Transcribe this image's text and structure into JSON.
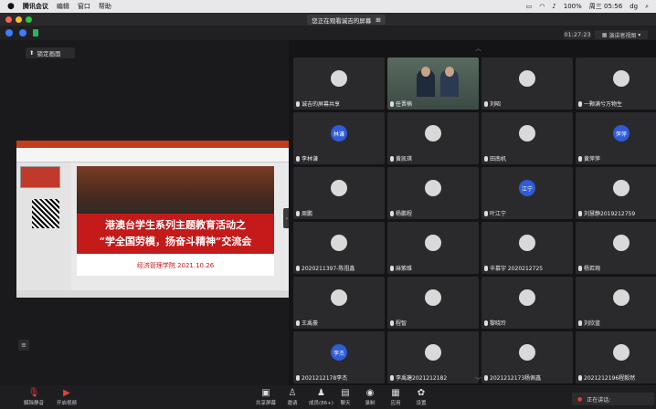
{
  "menubar": {
    "apple": "",
    "app": "腾讯会议",
    "items": [
      "编辑",
      "窗口",
      "帮助"
    ],
    "battery": "100%",
    "datetime": "周三 05:56",
    "user": "dg"
  },
  "sharing_banner": {
    "text": "您正在观看诚吉的屏幕"
  },
  "timer": "01:27:23",
  "view_button": "演讲者视图",
  "lock_button": "锁定画面",
  "slide": {
    "title1": "港澳台学生系列主题教育活动之",
    "title2": "“学全国劳模，扬奋斗精神”交流会",
    "footer": "经济管理学院 2021.10.26"
  },
  "participants": [
    {
      "name": "诚吉的屏幕共享",
      "avatar": "",
      "video": false
    },
    {
      "name": "任晋楠",
      "avatar": "",
      "video": true
    },
    {
      "name": "刘昭",
      "avatar": "",
      "video": false
    },
    {
      "name": "一颗满兮万物生",
      "avatar": "",
      "video": false
    },
    {
      "name": "李林谦",
      "avatar": "林谦",
      "video": false
    },
    {
      "name": "黄凯琪",
      "avatar": "",
      "video": false
    },
    {
      "name": "田南机",
      "avatar": "",
      "video": false
    },
    {
      "name": "黄萍萍",
      "avatar": "萍萍",
      "video": false
    },
    {
      "name": "周鹏",
      "avatar": "",
      "video": false
    },
    {
      "name": "杨鹏程",
      "avatar": "",
      "video": false
    },
    {
      "name": "叶江宁",
      "avatar": "江宁",
      "video": false
    },
    {
      "name": "刘慧静2019212759",
      "avatar": "",
      "video": false
    },
    {
      "name": "2020211397-陈祖鑫",
      "avatar": "",
      "video": false
    },
    {
      "name": "麻紫维",
      "avatar": "",
      "video": false
    },
    {
      "name": "辛慕宇 2020212725",
      "avatar": "",
      "video": false
    },
    {
      "name": "杨若琬",
      "avatar": "",
      "video": false
    },
    {
      "name": "王禹豪",
      "avatar": "",
      "video": false
    },
    {
      "name": "程智",
      "avatar": "",
      "video": false
    },
    {
      "name": "黎晓玲",
      "avatar": "",
      "video": false
    },
    {
      "name": "刘欣蓝",
      "avatar": "",
      "video": false
    },
    {
      "name": "2021212178李杰",
      "avatar": "李杰",
      "video": false
    },
    {
      "name": "李禹瑭2021212182",
      "avatar": "",
      "video": false
    },
    {
      "name": "2021212173杨佩鑫",
      "avatar": "",
      "video": false
    },
    {
      "name": "2021212196程毅然",
      "avatar": "",
      "video": false
    }
  ],
  "bottombar": {
    "mute": "解除静音",
    "video": "开启视频",
    "share": "共享屏幕",
    "invite": "邀请",
    "members": "成员(86+)",
    "chat": "聊天",
    "record": "录制",
    "apps": "应用",
    "settings": "设置"
  },
  "speaking": "正在讲话:",
  "colors": {
    "accent": "#2e5bd8",
    "slide_red": "#c41a1a",
    "bg": "#1c1c1e"
  }
}
